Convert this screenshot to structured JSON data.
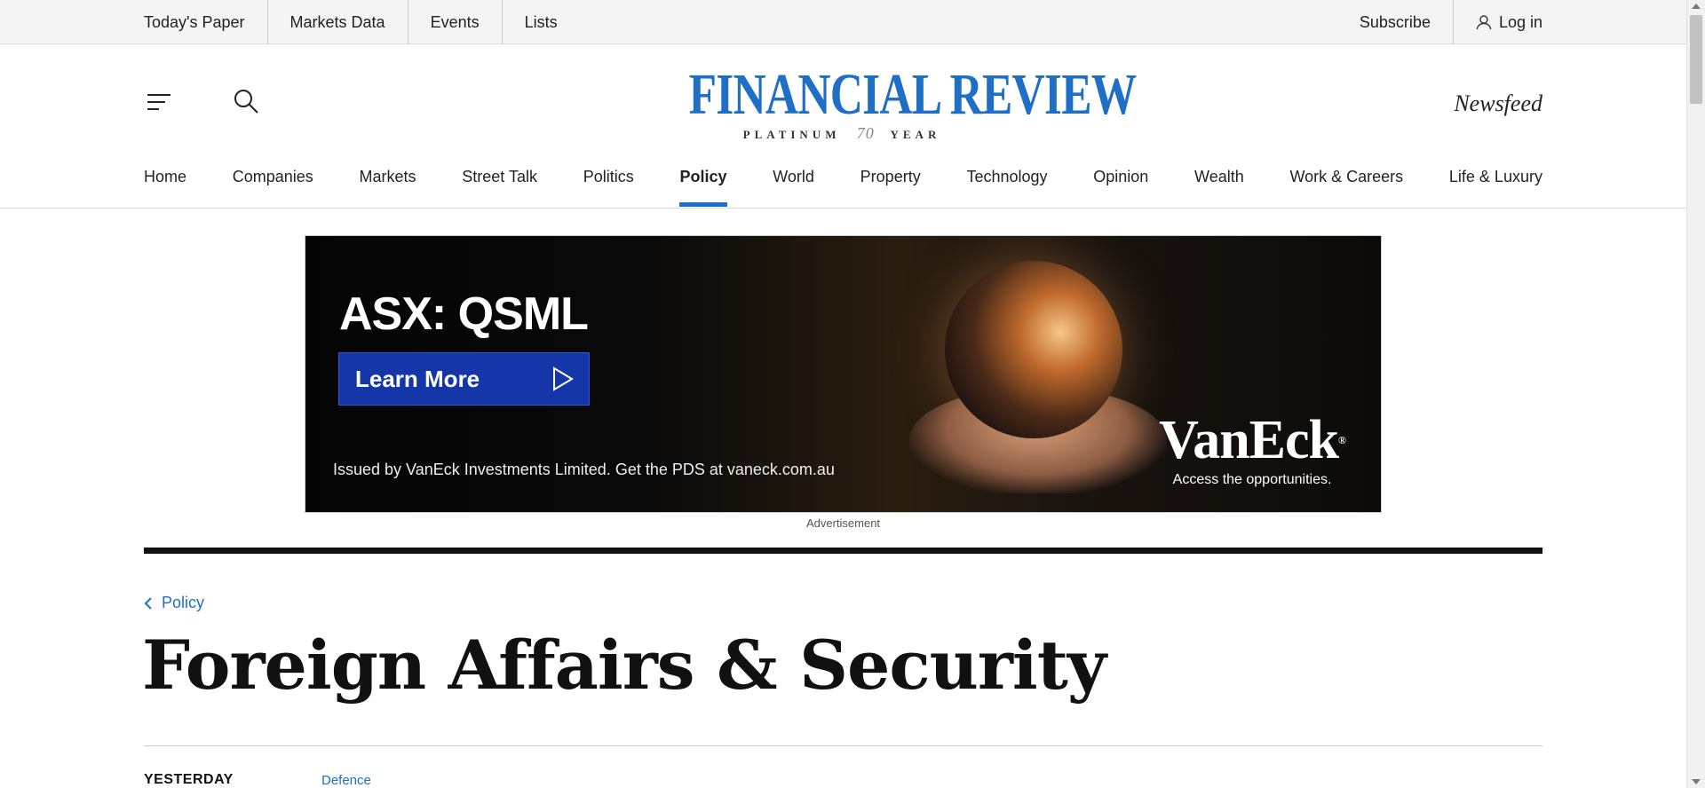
{
  "utility": {
    "left_links": [
      "Today's Paper",
      "Markets Data",
      "Events",
      "Lists"
    ],
    "subscribe": "Subscribe",
    "login": "Log in"
  },
  "header": {
    "logo_title": "FINANCIAL REVIEW",
    "logo_sub_left": "PLATINUM",
    "logo_sub_num": "70",
    "logo_sub_right": "YEAR",
    "newsfeed": "Newsfeed",
    "icons": {
      "menu": "menu-icon",
      "search": "search-icon",
      "login": "user-icon"
    }
  },
  "nav": {
    "items": [
      "Home",
      "Companies",
      "Markets",
      "Street Talk",
      "Politics",
      "Policy",
      "World",
      "Property",
      "Technology",
      "Opinion",
      "Wealth",
      "Work & Careers",
      "Life & Luxury"
    ],
    "active": "Policy",
    "accent": "#1f6fc6"
  },
  "ad": {
    "ticker": "ASX: QSML",
    "button": "Learn More",
    "disclaimer": "Issued by VanEck Investments Limited. Get the PDS at vaneck.com.au",
    "brand": "VanEck",
    "brand_mark": "®",
    "tagline": "Access the opportunities.",
    "label": "Advertisement"
  },
  "page": {
    "breadcrumb": "Policy",
    "title": "Foreign Affairs & Security",
    "date": "YESTERDAY",
    "tag": "Defence"
  }
}
